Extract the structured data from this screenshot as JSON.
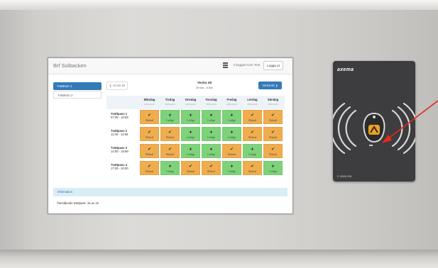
{
  "app": {
    "brand": "Brf Solbacken",
    "user_label": "Inloggad som Test",
    "logout_label": "Logga ut"
  },
  "sidebar": {
    "items": [
      {
        "label": "Tvättrum 1",
        "active": true
      },
      {
        "label": "Tvättrum 2",
        "active": false
      }
    ]
  },
  "week_nav": {
    "prev_label": "Vecka 48",
    "next_label": "Vecka 50",
    "title": "Vecka 49",
    "range": "30 Nov - 6 Dec"
  },
  "days": [
    {
      "name": "Måndag",
      "date": "2015-11-30"
    },
    {
      "name": "Tisdag",
      "date": "2015-12-01"
    },
    {
      "name": "Onsdag",
      "date": "2015-12-02"
    },
    {
      "name": "Torsdag",
      "date": "2015-12-03"
    },
    {
      "name": "Fredag",
      "date": "2015-12-04"
    },
    {
      "name": "Lördag",
      "date": "2015-12-05"
    },
    {
      "name": "Söndag",
      "date": "2015-12-06"
    }
  ],
  "status_labels": {
    "booked": "Bokad",
    "free": "Ledigt"
  },
  "slots": [
    {
      "name": "Tvättpass 1",
      "time": "07:00 - 10:59",
      "cells": [
        "booked",
        "free",
        "free",
        "free",
        "free",
        "booked",
        "booked"
      ]
    },
    {
      "name": "Tvättpass 2",
      "time": "11:00 - 13:59",
      "cells": [
        "booked",
        "booked",
        "free",
        "free",
        "free",
        "booked",
        "booked"
      ]
    },
    {
      "name": "Tvättpass 3",
      "time": "14:00 - 16:59",
      "cells": [
        "booked",
        "booked",
        "free",
        "free",
        "booked",
        "free",
        "booked"
      ]
    },
    {
      "name": "Tvättpass 4",
      "time": "17:00 - 20:00",
      "cells": [
        "booked",
        "free",
        "booked",
        "booked",
        "free",
        "booked",
        "free"
      ]
    }
  ],
  "info": {
    "header": "Information",
    "text": "Återstående tvättpass: 15 av 15"
  },
  "reader": {
    "brand": "axema",
    "model": "C-3000 EM"
  },
  "colors": {
    "booked": "#f0ad4e",
    "free": "#7ed37a",
    "primary": "#337ab7",
    "arrow": "#e8261b"
  }
}
